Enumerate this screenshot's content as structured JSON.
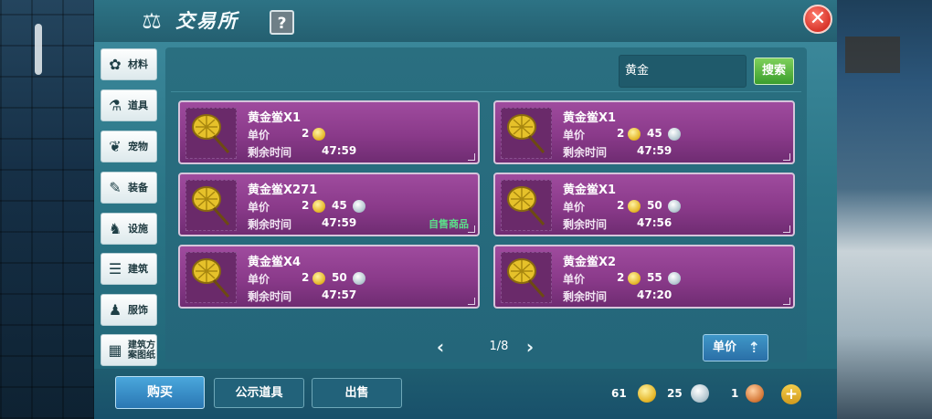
{
  "header": {
    "title": "交易所",
    "help_label": "?",
    "close_label": "✕"
  },
  "sidebar": {
    "items": [
      {
        "label": "材料",
        "icon": "material-icon"
      },
      {
        "label": "道具",
        "icon": "potion-icon"
      },
      {
        "label": "宠物",
        "icon": "paw-icon"
      },
      {
        "label": "装备",
        "icon": "equipment-icon"
      },
      {
        "label": "设施",
        "icon": "facility-icon"
      },
      {
        "label": "建筑",
        "icon": "building-icon"
      },
      {
        "label": "服饰",
        "icon": "clothing-icon"
      },
      {
        "label_line1": "建筑方",
        "label_line2": "案图纸",
        "icon": "blueprint-icon"
      }
    ]
  },
  "search": {
    "value": "黄金",
    "button_label": "搜索"
  },
  "labels": {
    "price": "单价",
    "time_left": "剩余时间",
    "self_sale": "自售商品"
  },
  "listings": [
    {
      "name": "黄金鲎X1",
      "gold": "2",
      "silver": "",
      "time": "47:59",
      "self": false
    },
    {
      "name": "黄金鲎X1",
      "gold": "2",
      "silver": "45",
      "time": "47:59",
      "self": false
    },
    {
      "name": "黄金鲎X271",
      "gold": "2",
      "silver": "45",
      "time": "47:59",
      "self": true
    },
    {
      "name": "黄金鲎X1",
      "gold": "2",
      "silver": "50",
      "time": "47:56",
      "self": false
    },
    {
      "name": "黄金鲎X4",
      "gold": "2",
      "silver": "50",
      "time": "47:57",
      "self": false
    },
    {
      "name": "黄金鲎X2",
      "gold": "2",
      "silver": "55",
      "time": "47:20",
      "self": false
    }
  ],
  "pagination": {
    "text": "1/8",
    "prev_icon": "chevron-left-icon",
    "next_icon": "chevron-right-icon"
  },
  "sort": {
    "label": "单价"
  },
  "bottom_tabs": {
    "buy": "购买",
    "public": "公示道具",
    "sell": "出售"
  },
  "currency": {
    "gold": "61",
    "silver": "25",
    "copper": "1"
  }
}
